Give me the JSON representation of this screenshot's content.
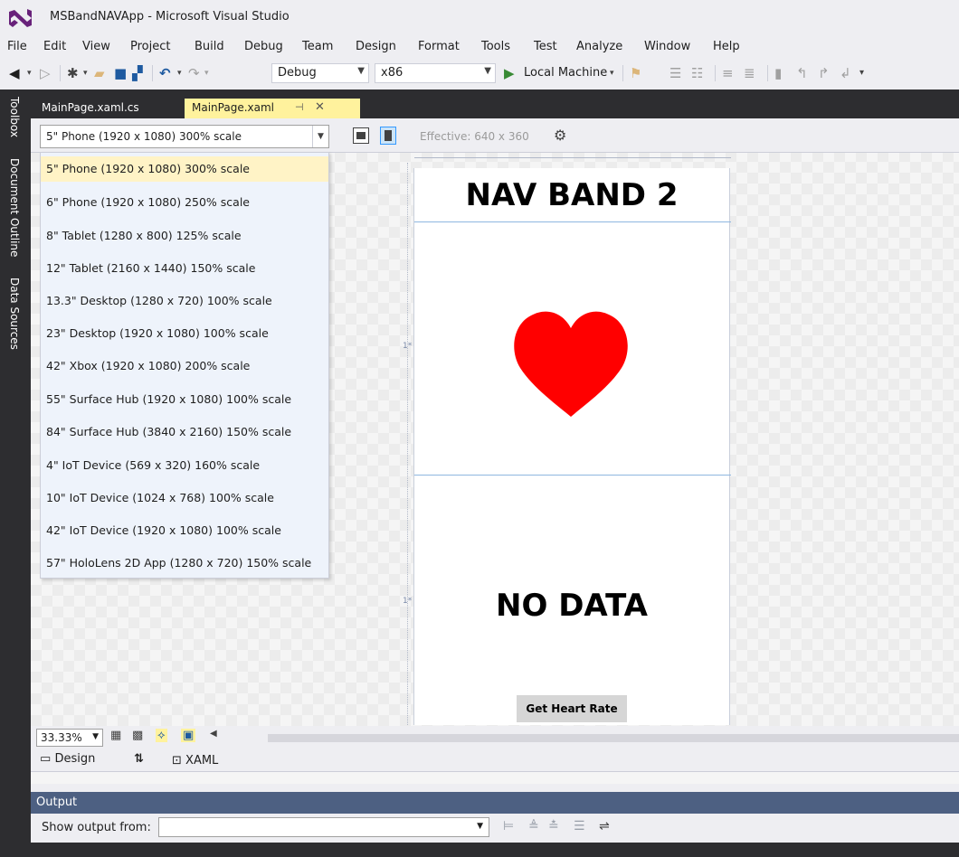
{
  "window": {
    "title": "MSBandNAVApp - Microsoft Visual Studio"
  },
  "menu": [
    "File",
    "Edit",
    "View",
    "Project",
    "Build",
    "Debug",
    "Team",
    "Design",
    "Format",
    "Tools",
    "Test",
    "Analyze",
    "Window",
    "Help"
  ],
  "toolbar": {
    "configuration": "Debug",
    "platform": "x86",
    "run_target": "Local Machine"
  },
  "sidebar_tabs": [
    "Toolbox",
    "Document Outline",
    "Data Sources"
  ],
  "doc_tabs": {
    "code_tab": "MainPage.xaml.cs",
    "active_tab": "MainPage.xaml"
  },
  "designer": {
    "device_selected": "5\" Phone (1920 x 1080) 300% scale",
    "effective_resolution": "Effective: 640 x 360",
    "device_options": [
      "5\" Phone (1920 x 1080) 300% scale",
      "6\" Phone (1920 x 1080) 250% scale",
      "8\" Tablet (1280 x 800) 125% scale",
      "12\" Tablet (2160 x 1440) 150% scale",
      "13.3\" Desktop (1280 x 720) 100% scale",
      "23\" Desktop (1920 x 1080) 100% scale",
      "42\" Xbox (1920 x 1080) 200% scale",
      "55\" Surface Hub (1920 x 1080) 100% scale",
      "84\" Surface Hub (3840 x 2160) 150% scale",
      "4\" IoT Device (569 x 320) 160% scale",
      "10\" IoT Device (1024 x 768) 100% scale",
      "42\" IoT Device (1920 x 1080) 100% scale",
      "57\" HoloLens 2D App (1280 x 720) 150% scale"
    ],
    "zoom": "33.33%",
    "row_markers": [
      "1*",
      "1*"
    ]
  },
  "app": {
    "title": "NAV BAND 2",
    "status": "NO DATA",
    "button_label": "Get Heart Rate",
    "heart_color": "#ff0000"
  },
  "view_tabs": {
    "design": "Design",
    "xaml": "XAML"
  },
  "output": {
    "title": "Output",
    "show_from_label": "Show output from:",
    "source_value": ""
  }
}
